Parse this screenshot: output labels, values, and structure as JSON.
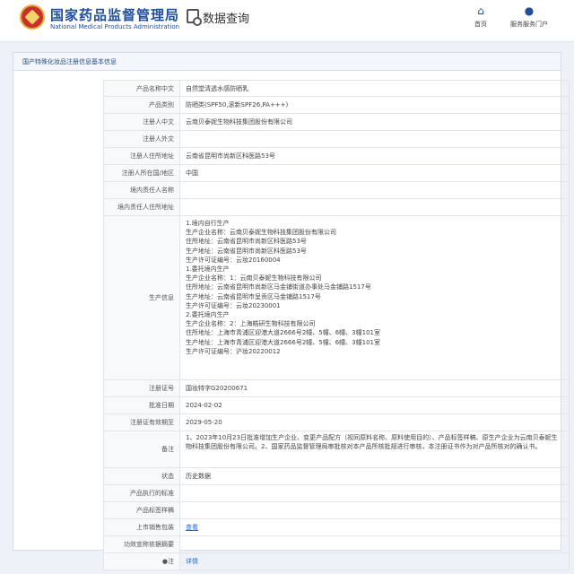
{
  "header": {
    "org_name": "国家药品监督管理局",
    "org_en": "National Medical Products Administration",
    "query_title": "数据查询",
    "nav_home": "首页",
    "nav_portal": "服务服务门户"
  },
  "panel": {
    "title": "国产特殊化妆品注册信息基本信息"
  },
  "fields": {
    "product_name": {
      "label": "产品名称中文",
      "value": "自然堂清透水感防晒乳"
    },
    "product_category": {
      "label": "产品类别",
      "value": "防晒类(SPF50,滚新SPF26,PA+++)"
    },
    "registrant_cn": {
      "label": "注册人中文",
      "value": "云南贝泰妮生物科技集团股份有限公司"
    },
    "registrant_foreign": {
      "label": "注册人外文",
      "value": ""
    },
    "registrant_address": {
      "label": "注册人住所地址",
      "value": "云南省昆明市尚新区科医路53号"
    },
    "registrant_region": {
      "label": "注册人所在国/地区",
      "value": "中国"
    },
    "domestic_person": {
      "label": "境内责任人名称",
      "value": ""
    },
    "domestic_address": {
      "label": "境内责任人住所地址",
      "value": ""
    },
    "production": {
      "label": "生产信息",
      "lines": [
        "1.境内自行生产",
        "生产企业名称：云南贝泰妮生物科技集团股份有限公司",
        "住所地址：云南省昆明市尚新区科医路53号",
        "生产地址：云南省昆明市尚新区科医路53号",
        "生产许可证编号：云妆20160004",
        "1.委托境内生产",
        "生产企业名称：1：云南贝泰妮生物科技有限公司",
        "住所地址：云南省昆明市尚新区马金铺街道办事处马金铺路1517号",
        "生产地址：云南省昆明市呈贡区马金铺路1517号",
        "生产许可证编号：云妆20230001",
        "2.委托境内生产",
        "生产企业名称：2：上海皓研生物科技有限公司",
        "住所地址：上海市青浦区迎港大道2666号2幢、5幢、6幢、3幢101室",
        "生产地址：上海市青浦区迎港大道2666号2幢、5幢、6幢、3幢101室",
        "生产许可证编号：沪妆20220012"
      ]
    },
    "reg_number": {
      "label": "注册证号",
      "value": "国妆特字G20200671"
    },
    "approval_date": {
      "label": "批准日期",
      "value": "2024-02-02"
    },
    "valid_until": {
      "label": "注册证有效期至",
      "value": "2029-05-20"
    },
    "remarks": {
      "label": "备注",
      "value": "1、2023年10月23日批准增加生产企业、变更产品配方（视同原料名称、原料使用目的）、产品标签样稿、原生产企业为云南贝泰妮生物科技集团股份有限公司。2、国家药品监督管理局审批核对本产品所核批规进行审核，本注册证书作为对产品所核对的确认书。"
    },
    "status": {
      "label": "状态",
      "value": "历史数据"
    },
    "standard": {
      "label": "产品执行的标准",
      "value": ""
    },
    "label_sample": {
      "label": "产品标签样稿",
      "value": ""
    },
    "sales_pack": {
      "label": "上市销售包装",
      "value": "查看"
    },
    "efficacy_summary": {
      "label": "功效宣称依据摘要",
      "value": ""
    },
    "note": {
      "label": "●注",
      "value": "详情"
    }
  }
}
